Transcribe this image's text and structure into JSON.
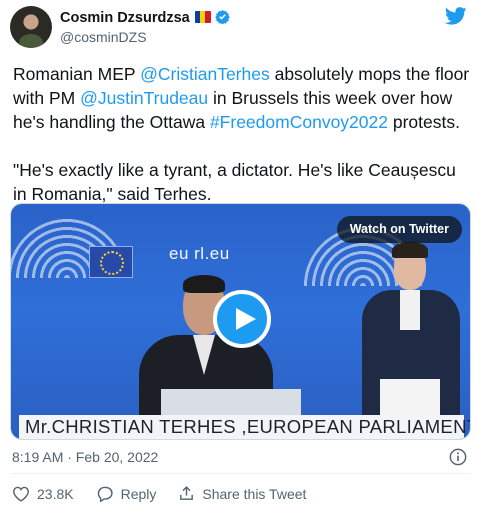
{
  "author": {
    "name": "Cosmin Dzsurdzsa",
    "handle": "@cosminDZS"
  },
  "tweet": {
    "p1_a": "Romanian MEP ",
    "p1_mention1": "@CristianTerhes",
    "p1_b": " absolutely mops the floor with PM ",
    "p1_mention2": "@JustinTrudeau",
    "p1_c": " in Brussels this week over how he's handling the Ottawa ",
    "p1_hashtag": "#FreedomConvoy2022",
    "p1_d": "  protests.",
    "p2": " \"He's exactly like a tyrant, a dictator. He's like Ceaușescu in Romania,\" said Terhes."
  },
  "video": {
    "watch_label": "Watch on Twitter",
    "wall_text": "eu          rl.eu",
    "caption": "Mr.CHRISTIAN TERHES ,EUROPEAN PARLIAMENT"
  },
  "timestamp": "8:19 AM · Feb 20, 2022",
  "actions": {
    "likes": "23.8K",
    "reply": "Reply",
    "share": "Share this Tweet"
  },
  "colors": {
    "accent": "#1d9bf0",
    "like_red": "#536471"
  }
}
